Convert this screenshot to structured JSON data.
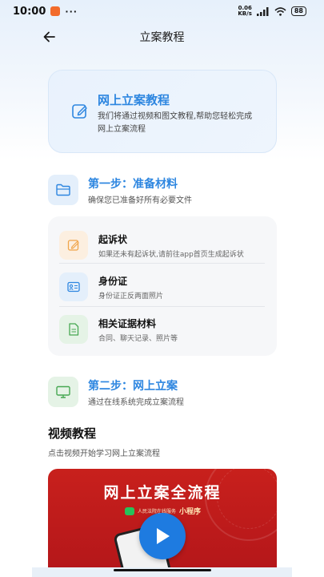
{
  "status_bar": {
    "time": "10:00",
    "dots": "···",
    "net_speed_value": "0.06",
    "net_speed_unit": "KB/s",
    "battery": "88"
  },
  "nav": {
    "title": "立案教程"
  },
  "hero": {
    "title": "网上立案教程",
    "description": "我们将通过视频和图文教程,帮助您轻松完成网上立案流程"
  },
  "step1": {
    "title": "第一步：准备材料",
    "subtitle": "确保您已准备好所有必要文件",
    "materials": [
      {
        "title": "起诉状",
        "desc": "如果还未有起诉状,请前往app首页生成起诉状",
        "icon": "edit-icon"
      },
      {
        "title": "身份证",
        "desc": "身份证正反两面照片",
        "icon": "id-card-icon"
      },
      {
        "title": "相关证据材料",
        "desc": "合同、聊天记录、照片等",
        "icon": "document-icon"
      }
    ]
  },
  "step2": {
    "title": "第二步：网上立案",
    "subtitle": "通过在线系统完成立案流程"
  },
  "video_section": {
    "title": "视频教程",
    "subtitle": "点击视频开始学习网上立案流程",
    "video_title": "网上立案全流程",
    "brand_small": "人民法院在线服务",
    "brand_big": "小程序"
  },
  "colors": {
    "accent": "#2d86e0",
    "video_red": "#c8201c",
    "play_blue": "#1e7be0"
  }
}
